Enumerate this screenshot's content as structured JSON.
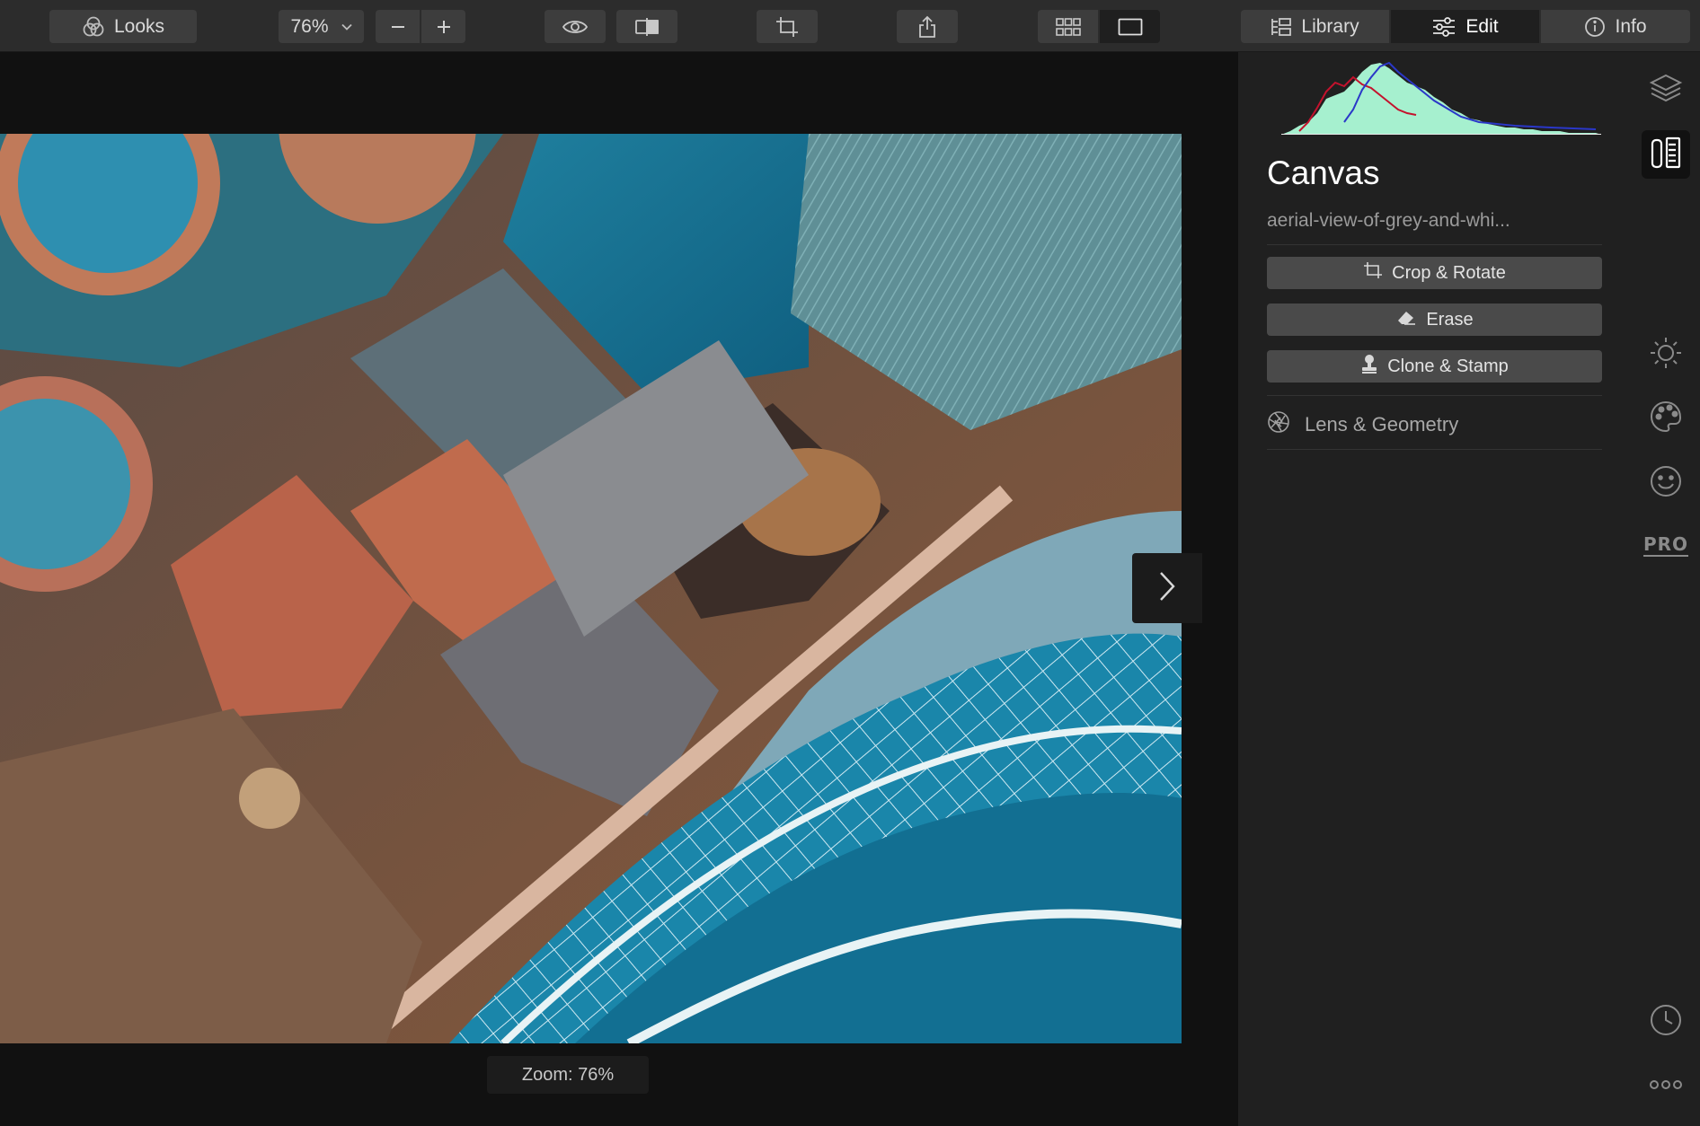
{
  "toolbar": {
    "looks_label": "Looks",
    "zoom_value": "76%",
    "nav_tabs": [
      {
        "label": "Library",
        "active": false
      },
      {
        "label": "Edit",
        "active": true
      },
      {
        "label": "Info",
        "active": false
      }
    ]
  },
  "canvas": {
    "zoom_label": "Zoom: 76%"
  },
  "panel": {
    "title": "Canvas",
    "file_name": "aerial-view-of-grey-and-whi...",
    "tools": [
      {
        "label": "Crop & Rotate",
        "icon": "crop-icon"
      },
      {
        "label": "Erase",
        "icon": "eraser-icon"
      },
      {
        "label": "Clone & Stamp",
        "icon": "stamp-icon"
      }
    ],
    "lens_label": "Lens & Geometry"
  },
  "sidebar": {
    "pro_label": "PRO",
    "icons": [
      "layers-icon",
      "canvas-tools-icon",
      "sun-icon",
      "palette-icon",
      "face-icon",
      "pro-icon",
      "history-icon",
      "more-icon"
    ]
  },
  "colors": {
    "accent_active_bg": "#1f1f1f",
    "panel_bg": "#202020",
    "toolbar_bg": "#2c2c2c",
    "button_bg": "#4a4a4a",
    "histogram_green": "#a6f0cf",
    "histogram_red": "#c4122d",
    "histogram_blue": "#2a37c8"
  }
}
